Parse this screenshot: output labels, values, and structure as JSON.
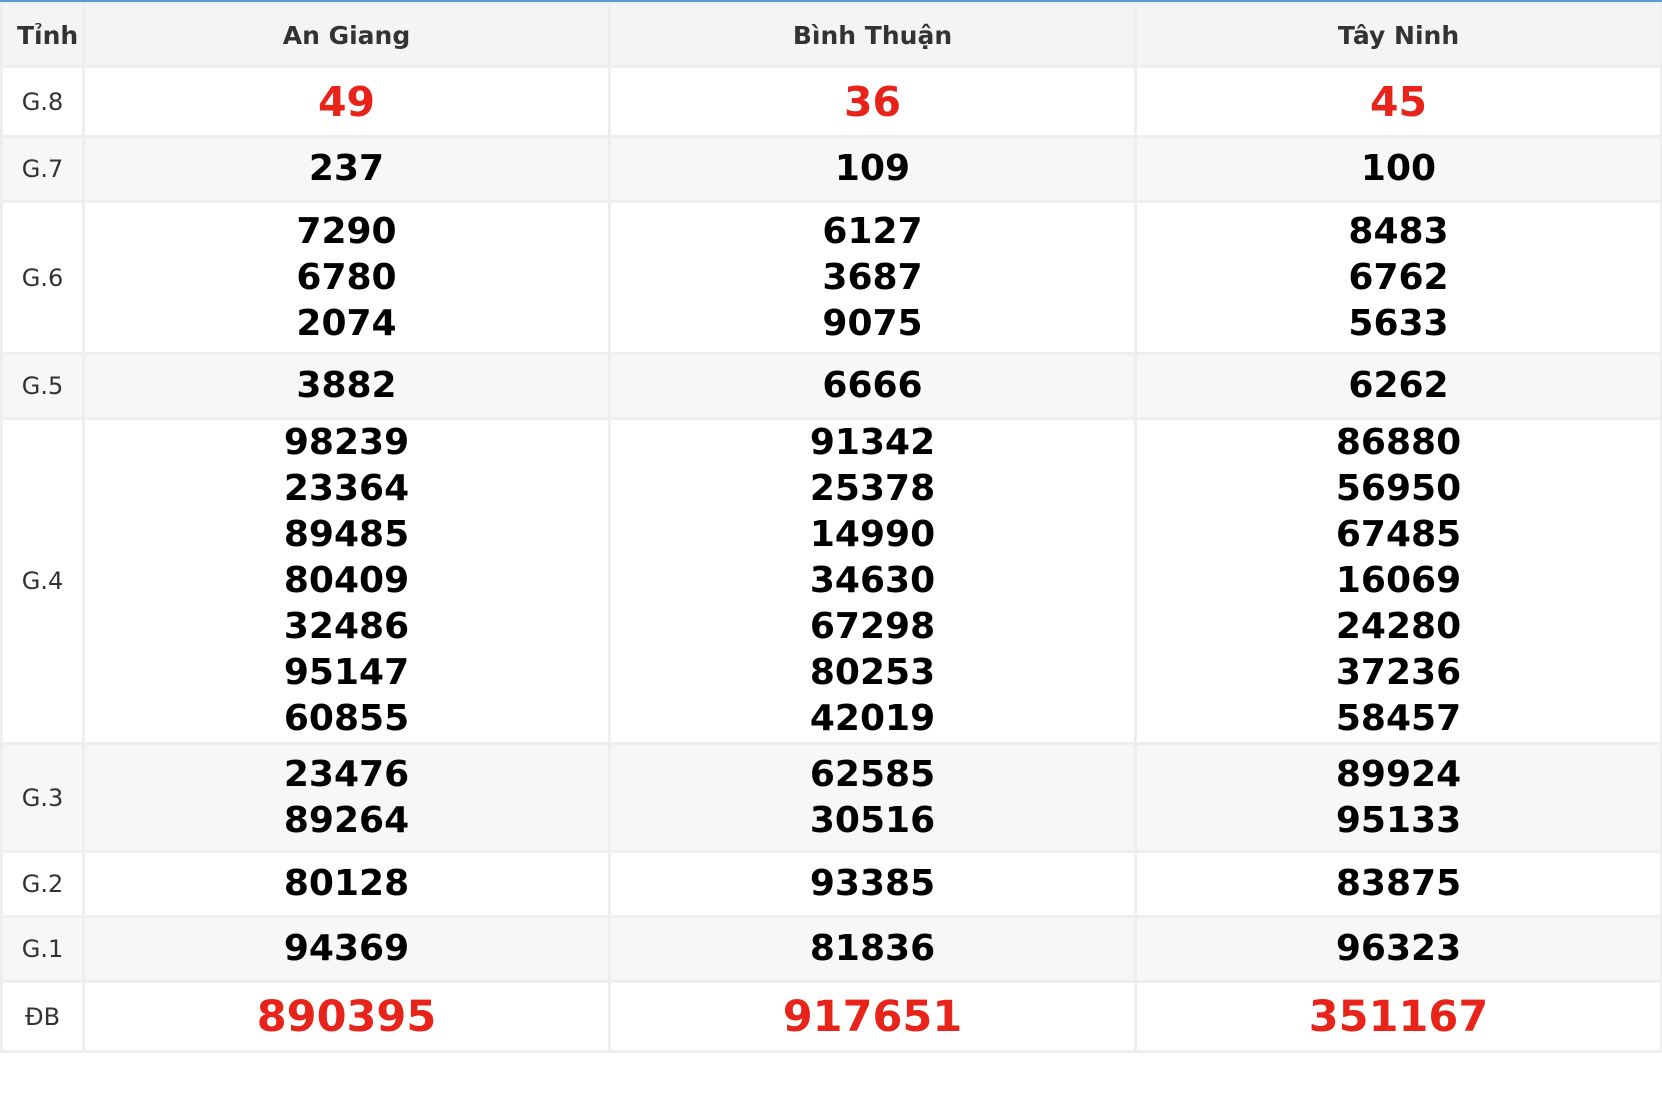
{
  "header": {
    "prize_col": "Tỉnh",
    "provinces": [
      "An Giang",
      "Bình Thuận",
      "Tây Ninh"
    ]
  },
  "rows": [
    {
      "label": "G.8",
      "values": [
        [
          "49"
        ],
        [
          "36"
        ],
        [
          "45"
        ]
      ]
    },
    {
      "label": "G.7",
      "values": [
        [
          "237"
        ],
        [
          "109"
        ],
        [
          "100"
        ]
      ]
    },
    {
      "label": "G.6",
      "values": [
        [
          "7290",
          "6780",
          "2074"
        ],
        [
          "6127",
          "3687",
          "9075"
        ],
        [
          "8483",
          "6762",
          "5633"
        ]
      ]
    },
    {
      "label": "G.5",
      "values": [
        [
          "3882"
        ],
        [
          "6666"
        ],
        [
          "6262"
        ]
      ]
    },
    {
      "label": "G.4",
      "values": [
        [
          "98239",
          "23364",
          "89485",
          "80409",
          "32486",
          "95147",
          "60855"
        ],
        [
          "91342",
          "25378",
          "14990",
          "34630",
          "67298",
          "80253",
          "42019"
        ],
        [
          "86880",
          "56950",
          "67485",
          "16069",
          "24280",
          "37236",
          "58457"
        ]
      ]
    },
    {
      "label": "G.3",
      "values": [
        [
          "23476",
          "89264"
        ],
        [
          "62585",
          "30516"
        ],
        [
          "89924",
          "95133"
        ]
      ]
    },
    {
      "label": "G.2",
      "values": [
        [
          "80128"
        ],
        [
          "93385"
        ],
        [
          "83875"
        ]
      ]
    },
    {
      "label": "G.1",
      "values": [
        [
          "94369"
        ],
        [
          "81836"
        ],
        [
          "96323"
        ]
      ]
    },
    {
      "label": "ĐB",
      "values": [
        [
          "890395"
        ],
        [
          "917651"
        ],
        [
          "351167"
        ]
      ]
    }
  ],
  "colors": {
    "highlight": "#e8231a",
    "accent_line": "#5b9bd5"
  }
}
